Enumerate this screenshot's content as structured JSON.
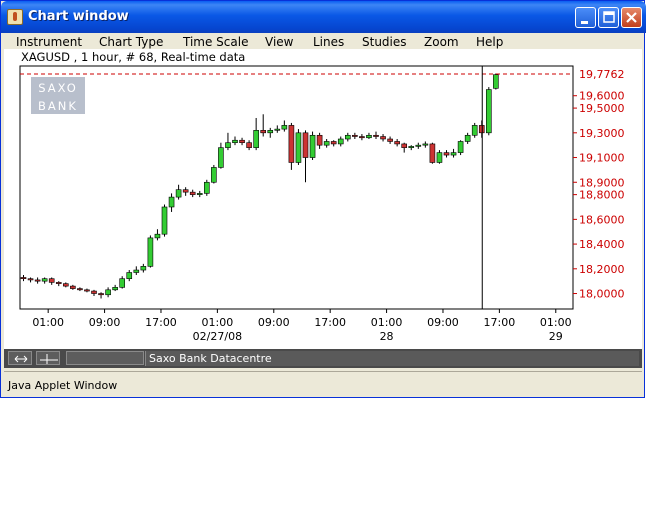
{
  "window": {
    "title": "Chart window",
    "status_text": "Java Applet Window"
  },
  "menu": [
    "Instrument",
    "Chart Type",
    "Time Scale",
    "View",
    "Lines",
    "Studies",
    "Zoom",
    "Help"
  ],
  "chart": {
    "header": "XAGUSD , 1 hour, # 68, Real-time data",
    "watermark": [
      "SAXO",
      "BANK"
    ],
    "current_price_label": "19,7762",
    "datacentre_label": "Saxo Bank Datacentre"
  },
  "colors": {
    "up_candle": "#33cc33",
    "down_candle": "#cc3333",
    "price_label": "#cc0000",
    "titlebar": "#0a58e6"
  },
  "chart_data": {
    "type": "candlestick",
    "title": "XAGUSD , 1 hour, # 68, Real-time data",
    "y_tick_labels": [
      "19,6000",
      "19,5000",
      "19,3000",
      "19,1000",
      "18,9000",
      "18,8000",
      "18,6000",
      "18,4000",
      "18,2000",
      "18,0000"
    ],
    "y_tick_values": [
      19.6,
      19.5,
      19.3,
      19.1,
      18.9,
      18.8,
      18.6,
      18.4,
      18.2,
      18.0
    ],
    "current_price": 19.7762,
    "ylim": [
      17.9,
      19.8
    ],
    "x_tick_labels": [
      {
        "time": "01:00",
        "date": "",
        "bar": 3.5
      },
      {
        "time": "09:00",
        "date": "",
        "bar": 11.5
      },
      {
        "time": "17:00",
        "date": "",
        "bar": 19.5
      },
      {
        "time": "01:00",
        "date": "02/27/08",
        "bar": 27.5
      },
      {
        "time": "09:00",
        "date": "",
        "bar": 35.5
      },
      {
        "time": "17:00",
        "date": "",
        "bar": 43.5
      },
      {
        "time": "01:00",
        "date": "28",
        "bar": 51.5
      },
      {
        "time": "09:00",
        "date": "",
        "bar": 59.5
      },
      {
        "time": "17:00",
        "date": "",
        "bar": 67.5
      },
      {
        "time": "01:00",
        "date": "29",
        "bar": 75.5
      }
    ],
    "cursor_bar": 65,
    "candles": [
      [
        18.13,
        18.12,
        18.15,
        18.1
      ],
      [
        18.12,
        18.11,
        18.13,
        18.09
      ],
      [
        18.11,
        18.1,
        18.13,
        18.08
      ],
      [
        18.1,
        18.12,
        18.13,
        18.08
      ],
      [
        18.12,
        18.09,
        18.13,
        18.07
      ],
      [
        18.09,
        18.08,
        18.1,
        18.06
      ],
      [
        18.08,
        18.06,
        18.09,
        18.05
      ],
      [
        18.06,
        18.04,
        18.07,
        18.03
      ],
      [
        18.04,
        18.03,
        18.05,
        18.02
      ],
      [
        18.03,
        18.02,
        18.04,
        18.01
      ],
      [
        18.02,
        18.0,
        18.03,
        17.98
      ],
      [
        18.0,
        17.99,
        18.01,
        17.96
      ],
      [
        17.99,
        18.03,
        18.05,
        17.97
      ],
      [
        18.03,
        18.05,
        18.07,
        18.02
      ],
      [
        18.05,
        18.12,
        18.14,
        18.04
      ],
      [
        18.12,
        18.17,
        18.19,
        18.1
      ],
      [
        18.17,
        18.19,
        18.22,
        18.15
      ],
      [
        18.19,
        18.22,
        18.24,
        18.17
      ],
      [
        18.22,
        18.45,
        18.47,
        18.21
      ],
      [
        18.45,
        18.48,
        18.52,
        18.43
      ],
      [
        18.48,
        18.7,
        18.72,
        18.46
      ],
      [
        18.7,
        18.78,
        18.81,
        18.66
      ],
      [
        18.78,
        18.84,
        18.88,
        18.76
      ],
      [
        18.84,
        18.82,
        18.86,
        18.79
      ],
      [
        18.82,
        18.8,
        18.84,
        18.78
      ],
      [
        18.8,
        18.81,
        18.83,
        18.78
      ],
      [
        18.81,
        18.9,
        18.92,
        18.79
      ],
      [
        18.9,
        19.02,
        19.04,
        18.89
      ],
      [
        19.02,
        19.18,
        19.22,
        19.01
      ],
      [
        19.18,
        19.22,
        19.3,
        19.16
      ],
      [
        19.22,
        19.24,
        19.27,
        19.2
      ],
      [
        19.24,
        19.22,
        19.26,
        19.2
      ],
      [
        19.22,
        19.18,
        19.24,
        19.16
      ],
      [
        19.18,
        19.32,
        19.42,
        19.16
      ],
      [
        19.32,
        19.3,
        19.45,
        19.27
      ],
      [
        19.3,
        19.32,
        19.34,
        19.26
      ],
      [
        19.32,
        19.33,
        19.36,
        19.3
      ],
      [
        19.33,
        19.36,
        19.4,
        19.31
      ],
      [
        19.36,
        19.06,
        19.38,
        19.0
      ],
      [
        19.06,
        19.3,
        19.33,
        19.04
      ],
      [
        19.3,
        19.1,
        19.32,
        18.9
      ],
      [
        19.1,
        19.28,
        19.31,
        19.08
      ],
      [
        19.28,
        19.2,
        19.3,
        19.17
      ],
      [
        19.2,
        19.23,
        19.25,
        19.18
      ],
      [
        19.23,
        19.21,
        19.24,
        19.19
      ],
      [
        19.21,
        19.25,
        19.27,
        19.19
      ],
      [
        19.25,
        19.28,
        19.3,
        19.23
      ],
      [
        19.28,
        19.27,
        19.3,
        19.25
      ],
      [
        19.27,
        19.26,
        19.29,
        19.24
      ],
      [
        19.26,
        19.28,
        19.3,
        19.25
      ],
      [
        19.28,
        19.27,
        19.31,
        19.25
      ],
      [
        19.27,
        19.25,
        19.29,
        19.23
      ],
      [
        19.25,
        19.23,
        19.27,
        19.21
      ],
      [
        19.23,
        19.21,
        19.25,
        19.19
      ],
      [
        19.21,
        19.18,
        19.22,
        19.14
      ],
      [
        19.18,
        19.19,
        19.2,
        19.16
      ],
      [
        19.19,
        19.2,
        19.22,
        19.17
      ],
      [
        19.2,
        19.21,
        19.23,
        19.18
      ],
      [
        19.21,
        19.06,
        19.22,
        19.05
      ],
      [
        19.06,
        19.14,
        19.16,
        19.05
      ],
      [
        19.14,
        19.12,
        19.16,
        19.1
      ],
      [
        19.12,
        19.14,
        19.17,
        19.1
      ],
      [
        19.14,
        19.23,
        19.24,
        19.12
      ],
      [
        19.23,
        19.28,
        19.3,
        19.21
      ],
      [
        19.28,
        19.36,
        19.38,
        19.26
      ],
      [
        19.36,
        19.3,
        19.4,
        19.26
      ],
      [
        19.3,
        19.65,
        19.67,
        19.28
      ],
      [
        19.66,
        19.77,
        19.78,
        19.65
      ]
    ]
  }
}
